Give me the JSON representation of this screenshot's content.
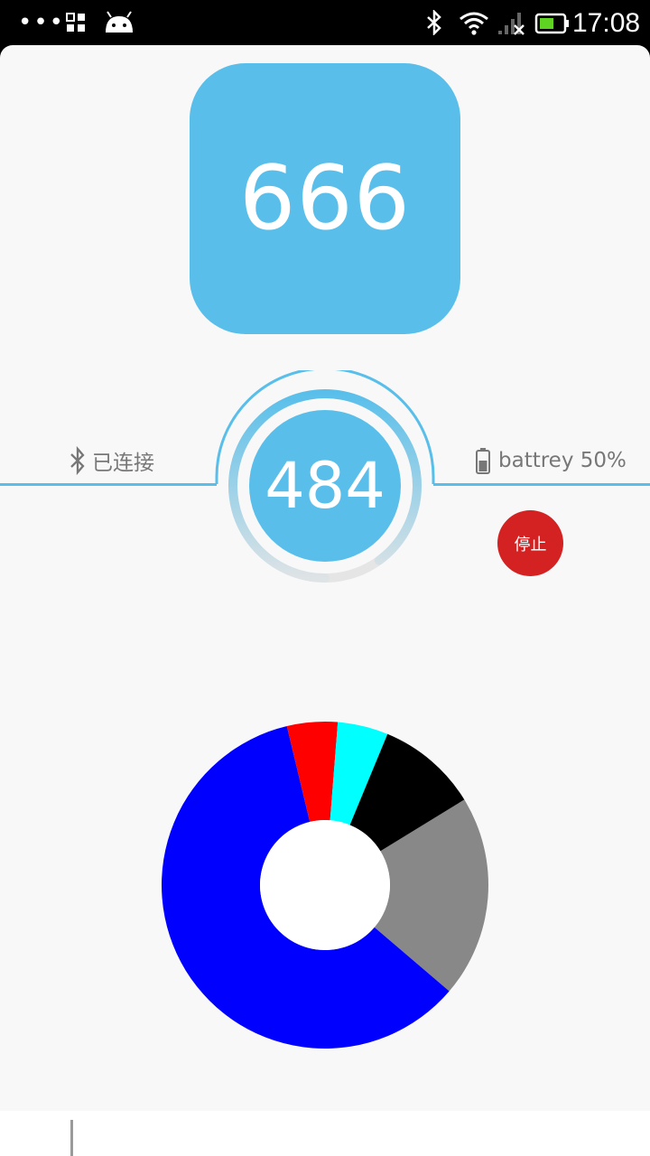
{
  "status_bar": {
    "time": "17:08",
    "icons": [
      "more-icon",
      "app-grid-icon",
      "android-icon",
      "bluetooth-icon",
      "wifi-icon",
      "signal-icon",
      "battery-icon"
    ]
  },
  "main_value": "666",
  "gauge": {
    "value": "484",
    "progress": 0.9,
    "color": "#59bfea",
    "track_color": "#e5e5e5"
  },
  "connection": {
    "icon": "bluetooth-icon",
    "label": "已连接"
  },
  "battery": {
    "icon": "battery-icon",
    "label": "battrey 50%"
  },
  "stop_button": {
    "label": "停止",
    "color": "#d42121"
  },
  "chart_data": {
    "type": "pie",
    "donut": true,
    "slices": [
      {
        "color": "#888888",
        "value": 20
      },
      {
        "color": "#0000ff",
        "value": 60
      },
      {
        "color": "#ff0000",
        "value": 5
      },
      {
        "color": "#00ffff",
        "value": 5
      },
      {
        "color": "#000000",
        "value": 10
      }
    ]
  }
}
